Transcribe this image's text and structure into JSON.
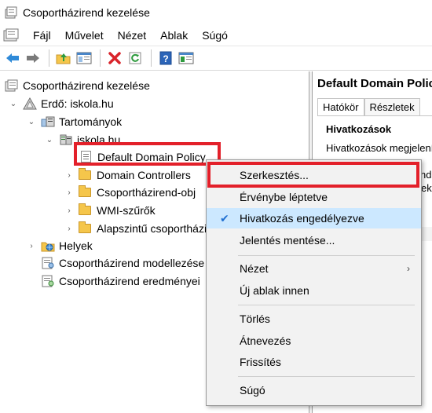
{
  "window": {
    "title": "Csoportházirend kezelése"
  },
  "menubar": {
    "items": [
      "Fájl",
      "Művelet",
      "Nézet",
      "Ablak",
      "Súgó"
    ]
  },
  "toolbar": {
    "buttons": [
      "back-arrow-icon",
      "forward-arrow-icon",
      "up-folder-icon",
      "show-hide-tree-icon",
      "delete-icon",
      "refresh-icon",
      "help-icon",
      "properties-icon"
    ]
  },
  "tree": {
    "root": "Csoportházirend kezelése",
    "forest": "Erdő: iskola.hu",
    "domains": "Tartományok",
    "domain": "iskola.hu",
    "default_policy": "Default Domain Policy",
    "domain_controllers": "Domain Controllers",
    "gpo_objects": "Csoportházirend-obj",
    "wmi_filters": "WMI-szűrők",
    "starter_gpos": "Alapszintű csoportházirend",
    "sites": "Helyek",
    "modeling": "Csoportházirend modellezése",
    "results": "Csoportházirend eredményei"
  },
  "right_pane": {
    "title": "Default Domain Policy",
    "tabs": [
      "Hatókör",
      "Részletek"
    ],
    "section": "Hivatkozások",
    "text": "Hivatkozások megjelenítése",
    "frag1": "nd-",
    "frag2": "ek"
  },
  "context_menu": {
    "edit": "Szerkesztés...",
    "enforce": "Érvénybe léptetve",
    "link_enabled": "Hivatkozás engedélyezve",
    "link_enabled_checked": true,
    "save_report": "Jelentés mentése...",
    "view": "Nézet",
    "new_window": "Új ablak innen",
    "delete": "Törlés",
    "rename": "Átnevezés",
    "refresh": "Frissítés",
    "help": "Súgó"
  },
  "colors": {
    "highlight_red": "#e3202a",
    "check_blue": "#1f6fd1"
  }
}
